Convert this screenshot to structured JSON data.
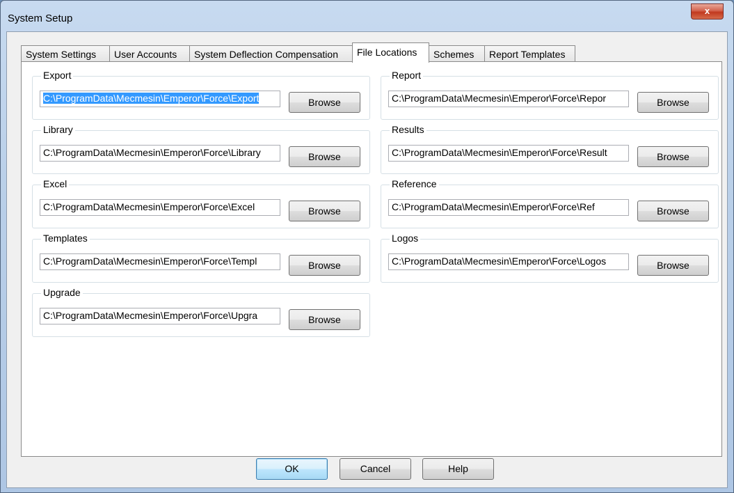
{
  "window": {
    "title": "System Setup",
    "close_glyph": "x"
  },
  "tabs": [
    {
      "label": "System Settings",
      "active": false
    },
    {
      "label": "User Accounts",
      "active": false
    },
    {
      "label": "System Deflection Compensation",
      "active": false
    },
    {
      "label": "File Locations",
      "active": true
    },
    {
      "label": "Schemes",
      "active": false
    },
    {
      "label": "Report Templates",
      "active": false
    }
  ],
  "groups": [
    {
      "label": "Export",
      "path": "C:\\ProgramData\\Mecmesin\\Emperor\\Force\\Export",
      "browse": "Browse",
      "selected": true
    },
    {
      "label": "Report",
      "path": "C:\\ProgramData\\Mecmesin\\Emperor\\Force\\Repor",
      "browse": "Browse",
      "selected": false
    },
    {
      "label": "Library",
      "path": "C:\\ProgramData\\Mecmesin\\Emperor\\Force\\Library",
      "browse": "Browse",
      "selected": false
    },
    {
      "label": "Results",
      "path": "C:\\ProgramData\\Mecmesin\\Emperor\\Force\\Result",
      "browse": "Browse",
      "selected": false
    },
    {
      "label": "Excel",
      "path": "C:\\ProgramData\\Mecmesin\\Emperor\\Force\\Excel",
      "browse": "Browse",
      "selected": false
    },
    {
      "label": "Reference",
      "path": "C:\\ProgramData\\Mecmesin\\Emperor\\Force\\Ref",
      "browse": "Browse",
      "selected": false
    },
    {
      "label": "Templates",
      "path": "C:\\ProgramData\\Mecmesin\\Emperor\\Force\\Templ",
      "browse": "Browse",
      "selected": false
    },
    {
      "label": "Logos",
      "path": "C:\\ProgramData\\Mecmesin\\Emperor\\Force\\Logos",
      "browse": "Browse",
      "selected": false
    },
    {
      "label": "Upgrade",
      "path": "C:\\ProgramData\\Mecmesin\\Emperor\\Force\\Upgra",
      "browse": "Browse",
      "selected": false
    }
  ],
  "buttons": {
    "ok": "OK",
    "cancel": "Cancel",
    "help": "Help"
  }
}
